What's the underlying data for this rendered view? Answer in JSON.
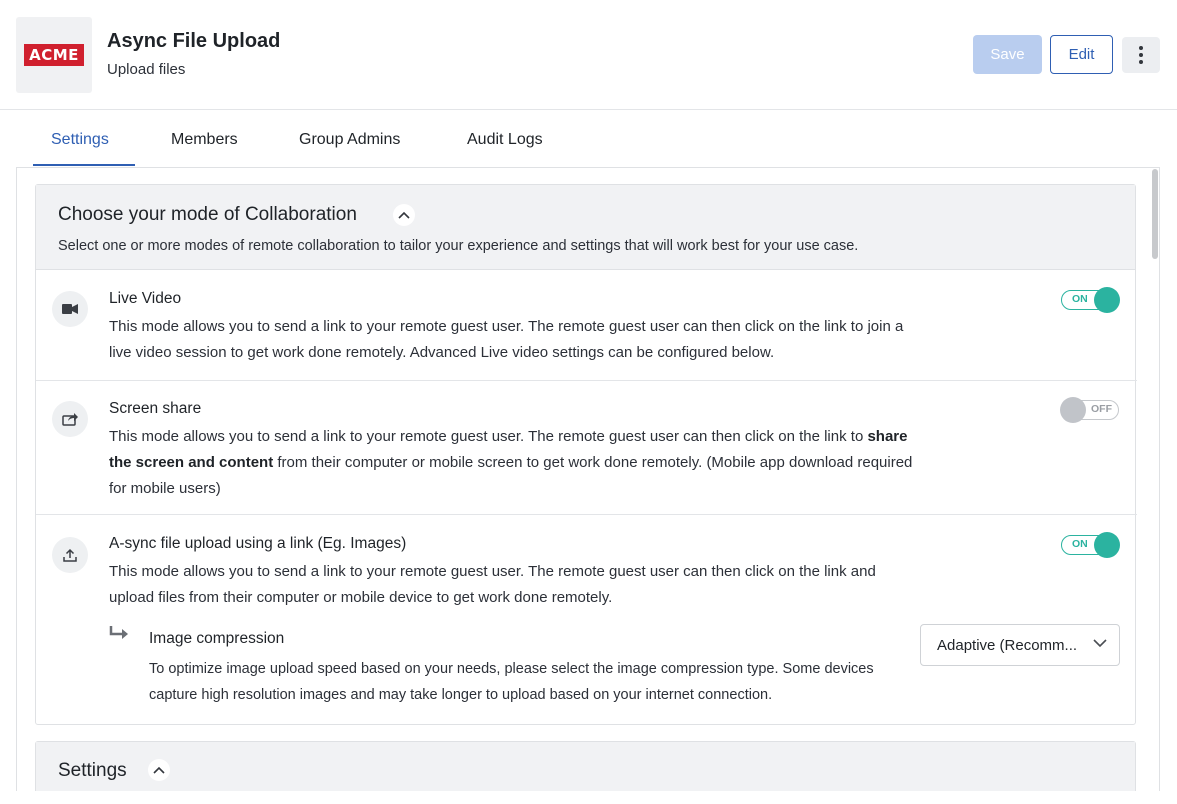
{
  "header": {
    "logo_text": "ACME",
    "title": "Async File Upload",
    "subtitle": "Upload files",
    "save_label": "Save",
    "edit_label": "Edit",
    "more_icon": "kebab-menu-icon"
  },
  "tabs": [
    {
      "label": "Settings",
      "active": true
    },
    {
      "label": "Members",
      "active": false
    },
    {
      "label": "Group Admins",
      "active": false
    },
    {
      "label": "Audit Logs",
      "active": false
    }
  ],
  "collaboration": {
    "title": "Choose your mode of Collaboration",
    "description": "Select one or more modes of remote collaboration to tailor your experience and settings that will work best for your use case.",
    "modes": [
      {
        "icon": "video-camera-icon",
        "title": "Live Video",
        "description": "This mode allows you to send a link to your remote guest user. The remote guest user can then click on the link to join a live video session to get work done remotely. Advanced Live video settings can be configured below.",
        "toggle": "ON"
      },
      {
        "icon": "share-screen-icon",
        "title": "Screen share",
        "desc_before": "This mode allows you to send a link to your remote guest user. The remote guest user can then click on the link to ",
        "desc_bold": "share the screen and content",
        "desc_after": " from their computer or mobile screen to get work done remotely. (Mobile app download required for mobile users)",
        "toggle": "OFF"
      },
      {
        "icon": "upload-icon",
        "title": "A-sync file upload using a link (Eg. Images)",
        "description": "This mode allows you to send a link to your remote guest user. The remote guest user can then click on the link and upload files from their computer or mobile device to get work done remotely.",
        "toggle": "ON"
      }
    ],
    "image_compression": {
      "title": "Image compression",
      "description": "To optimize image upload speed based on your needs, please select the image compression type. Some devices capture high resolution images and may take longer to upload based on your internet connection.",
      "selected": "Adaptive (Recomm..."
    }
  },
  "settings_section": {
    "title": "Settings"
  },
  "colors": {
    "accent": "#2f5fb3",
    "toggle_on": "#2bb3a0",
    "toggle_off": "#c1c4c9",
    "logo_red": "#d0202e"
  }
}
